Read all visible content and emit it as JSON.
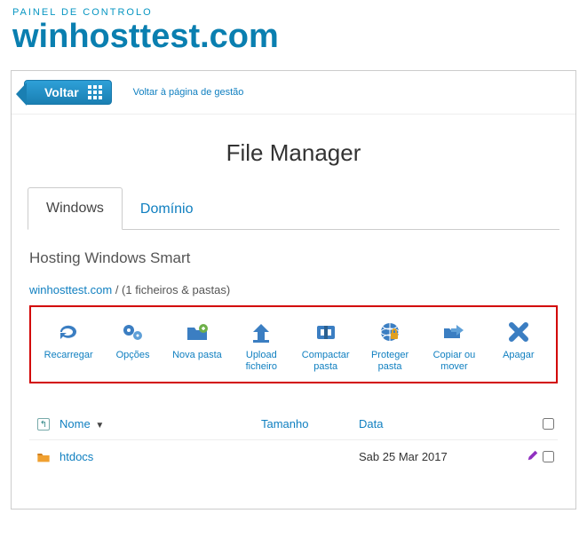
{
  "header": {
    "breadcrumb": "PAINEL DE CONTROLO",
    "domain": "winhosttest.com"
  },
  "topbar": {
    "back_label": "Voltar",
    "back_link": "Voltar à página de gestão"
  },
  "title": "File Manager",
  "tabs": [
    {
      "label": "Windows",
      "active": true
    },
    {
      "label": "Domínio",
      "active": false
    }
  ],
  "hosting_plan": "Hosting Windows Smart",
  "breadcrumb": {
    "root": "winhosttest.com",
    "suffix": " / (1 ficheiros & pastas)"
  },
  "toolbar": [
    {
      "id": "reload",
      "label": "Recarregar"
    },
    {
      "id": "options",
      "label": "Opções"
    },
    {
      "id": "newfolder",
      "label": "Nova pasta"
    },
    {
      "id": "upload",
      "label": "Upload ficheiro"
    },
    {
      "id": "compress",
      "label": "Compactar pasta"
    },
    {
      "id": "protect",
      "label": "Proteger pasta"
    },
    {
      "id": "copymove",
      "label": "Copiar ou mover"
    },
    {
      "id": "delete",
      "label": "Apagar"
    }
  ],
  "columns": {
    "name": "Nome",
    "size": "Tamanho",
    "date": "Data"
  },
  "rows": [
    {
      "name": "htdocs",
      "size": "",
      "date": "Sab 25 Mar 2017"
    }
  ]
}
